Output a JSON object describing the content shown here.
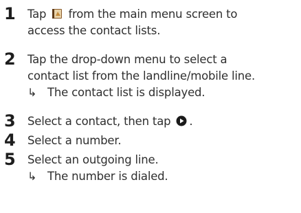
{
  "steps": [
    {
      "number": "1",
      "before_icon": "Tap",
      "icon": "contacts-book-icon",
      "after_icon": "from the main menu screen to",
      "line2": "access the contact lists."
    },
    {
      "number": "2",
      "line1": "Tap the drop-down menu to select a",
      "line2": "contact list from the landline/mobile line.",
      "result_arrow": "↳",
      "result": "The contact list is displayed."
    },
    {
      "number": "3",
      "before_icon": "Select a contact, then tap",
      "icon": "play-circle-icon",
      "after_icon": "."
    },
    {
      "number": "4",
      "line1": "Select a number."
    },
    {
      "number": "5",
      "line1": "Select an outgoing line.",
      "result_arrow": "↳",
      "result": "The number is dialed."
    }
  ]
}
